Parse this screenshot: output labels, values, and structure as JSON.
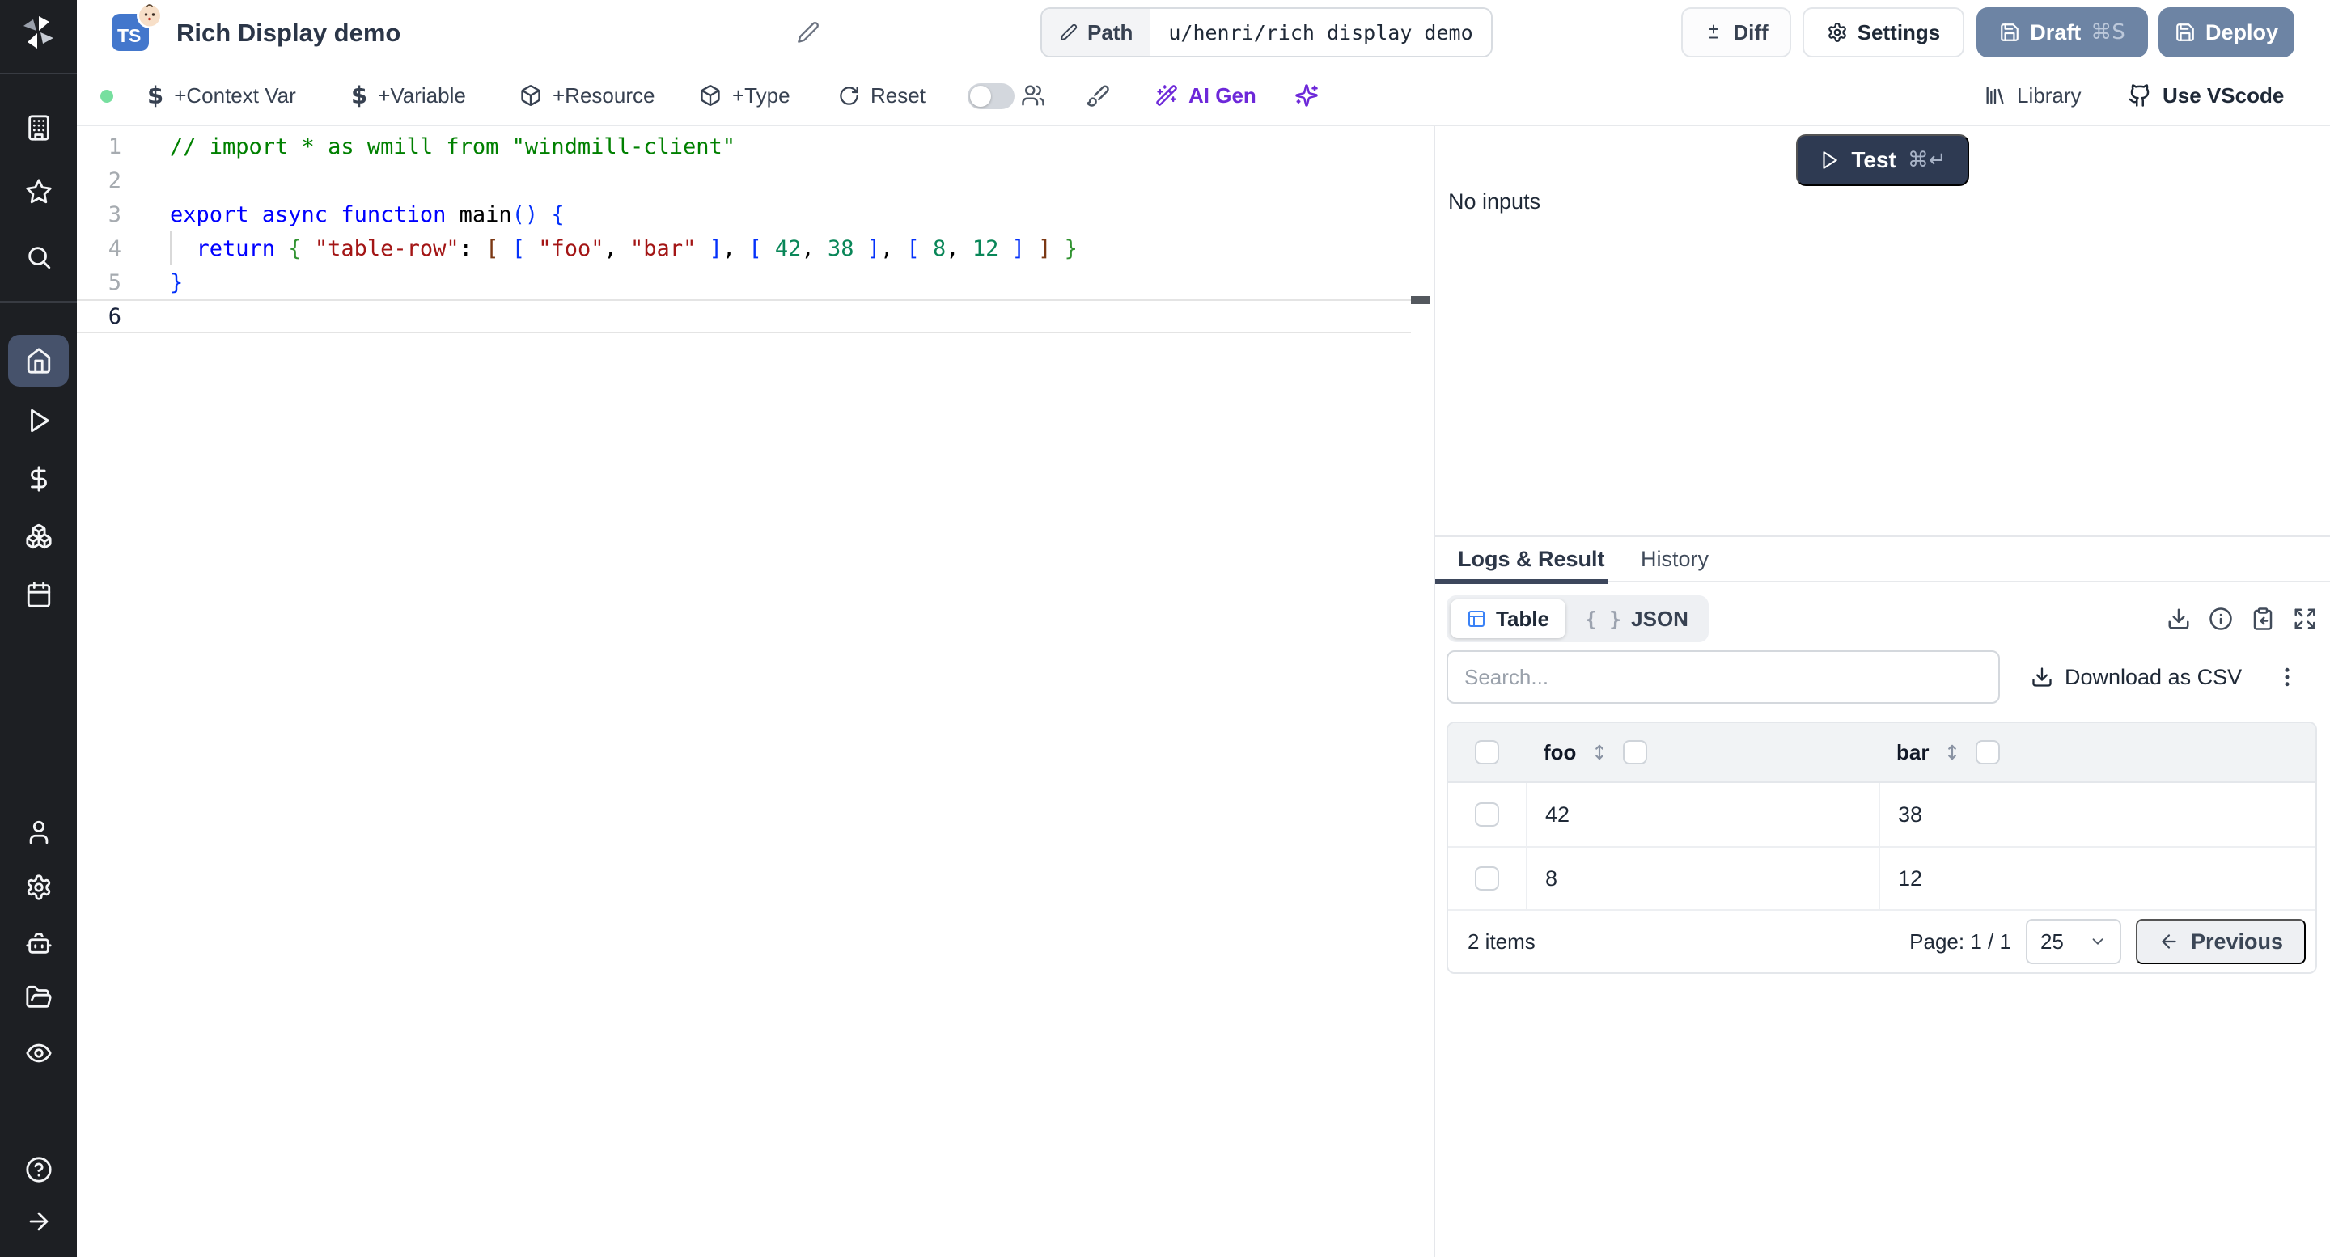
{
  "header": {
    "title": "Rich Display demo",
    "lang_badge": "TS",
    "path_label": "Path",
    "path_value": "u/henri/rich_display_demo",
    "diff_label": "Diff",
    "settings_label": "Settings",
    "draft_label": "Draft",
    "draft_shortcut": "⌘S",
    "deploy_label": "Deploy"
  },
  "toolbar": {
    "context_var": "+Context Var",
    "variable": "+Variable",
    "resource": "+Resource",
    "type": "+Type",
    "reset": "Reset",
    "ai_gen": "AI Gen",
    "library": "Library",
    "vscode": "Use VScode",
    "dollar": "$"
  },
  "sidebar": {
    "items": [
      "workspace",
      "favorites",
      "search",
      "home",
      "runs",
      "variables",
      "resources",
      "schedules",
      "user",
      "settings",
      "workers",
      "folders",
      "audit-logs",
      "help",
      "collapse"
    ]
  },
  "editor": {
    "lines": [
      {
        "num": "1",
        "tokens": [
          [
            "cm",
            "// import * as wmill from \"windmill-client\""
          ]
        ]
      },
      {
        "num": "2",
        "tokens": []
      },
      {
        "num": "3",
        "tokens": [
          [
            "kw",
            "export async function "
          ],
          [
            "pl",
            "main"
          ],
          [
            "b1",
            "()"
          ],
          [
            "pl",
            " "
          ],
          [
            "b1",
            "{"
          ]
        ]
      },
      {
        "num": "4",
        "guide": true,
        "tokens": [
          [
            "pl",
            "  "
          ],
          [
            "kw",
            "return"
          ],
          [
            "pl",
            " "
          ],
          [
            "b2",
            "{"
          ],
          [
            "pl",
            " "
          ],
          [
            "st",
            "\"table-row\""
          ],
          [
            "pl",
            ": "
          ],
          [
            "b3",
            "["
          ],
          [
            "pl",
            " "
          ],
          [
            "b1",
            "["
          ],
          [
            "pl",
            " "
          ],
          [
            "st",
            "\"foo\""
          ],
          [
            "pl",
            ", "
          ],
          [
            "st",
            "\"bar\""
          ],
          [
            "pl",
            " "
          ],
          [
            "b1",
            "]"
          ],
          [
            "pl",
            ", "
          ],
          [
            "b1",
            "["
          ],
          [
            "pl",
            " "
          ],
          [
            "nu",
            "42"
          ],
          [
            "pl",
            ", "
          ],
          [
            "nu",
            "38"
          ],
          [
            "pl",
            " "
          ],
          [
            "b1",
            "]"
          ],
          [
            "pl",
            ", "
          ],
          [
            "b1",
            "["
          ],
          [
            "pl",
            " "
          ],
          [
            "nu",
            "8"
          ],
          [
            "pl",
            ", "
          ],
          [
            "nu",
            "12"
          ],
          [
            "pl",
            " "
          ],
          [
            "b1",
            "]"
          ],
          [
            "pl",
            " "
          ],
          [
            "b3",
            "]"
          ],
          [
            "pl",
            " "
          ],
          [
            "b2",
            "}"
          ]
        ]
      },
      {
        "num": "5",
        "tokens": [
          [
            "b1",
            "}"
          ]
        ]
      },
      {
        "num": "6",
        "active": true,
        "tokens": []
      }
    ]
  },
  "run_panel": {
    "test_label": "Test",
    "test_shortcut": "⌘↵",
    "no_inputs": "No inputs",
    "tab_logs": "Logs & Result",
    "tab_history": "History",
    "view_table": "Table",
    "view_json": "JSON",
    "json_braces": "{ }",
    "search_placeholder": "Search...",
    "download_csv": "Download as CSV"
  },
  "result": {
    "table": {
      "columns": [
        "foo",
        "bar"
      ],
      "rows": [
        [
          "42",
          "38"
        ],
        [
          "8",
          "12"
        ]
      ],
      "items_label": "2 items",
      "page_label": "Page: 1 / 1",
      "page_size": "25",
      "prev_label": "Previous"
    }
  },
  "colors": {
    "slate_button": "#6d84a4",
    "test_button": "#2e3a52",
    "accent_purple": "#6d28d9",
    "ts_blue": "#4377cc",
    "status_green": "#77df9f",
    "table_icon_blue": "#3b82f6"
  }
}
